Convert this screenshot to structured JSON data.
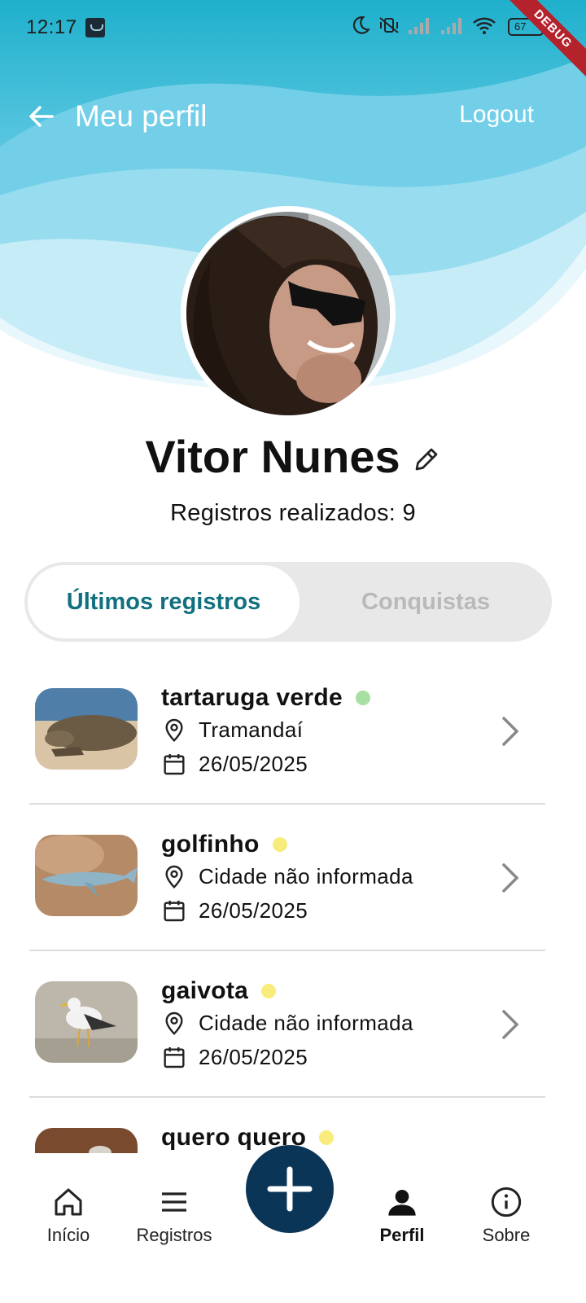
{
  "status_bar": {
    "time": "12:17",
    "battery": "67",
    "debug_label": "DEBUG"
  },
  "app_bar": {
    "title": "Meu perfil",
    "logout_label": "Logout"
  },
  "profile": {
    "name": "Vitor Nunes",
    "records_text": "Registros realizados: 9"
  },
  "tabs": {
    "recent_label": "Últimos registros",
    "achievements_label": "Conquistas"
  },
  "records": [
    {
      "name": "tartaruga verde",
      "city": "Tramandaí",
      "date": "26/05/2025",
      "status_color": "#a8e0a3"
    },
    {
      "name": "golfinho",
      "city": "Cidade não informada",
      "date": "26/05/2025",
      "status_color": "#f8ec7c"
    },
    {
      "name": "gaivota",
      "city": "Cidade não informada",
      "date": "26/05/2025",
      "status_color": "#f8ec7c"
    },
    {
      "name": "quero quero",
      "status_color": "#f8ec7c"
    }
  ],
  "bottom_nav": {
    "home_label": "Início",
    "records_label": "Registros",
    "profile_label": "Perfil",
    "about_label": "Sobre"
  },
  "colors": {
    "accent": "#11707f",
    "fab": "#0b3557",
    "wave": "#3fb8d2"
  }
}
